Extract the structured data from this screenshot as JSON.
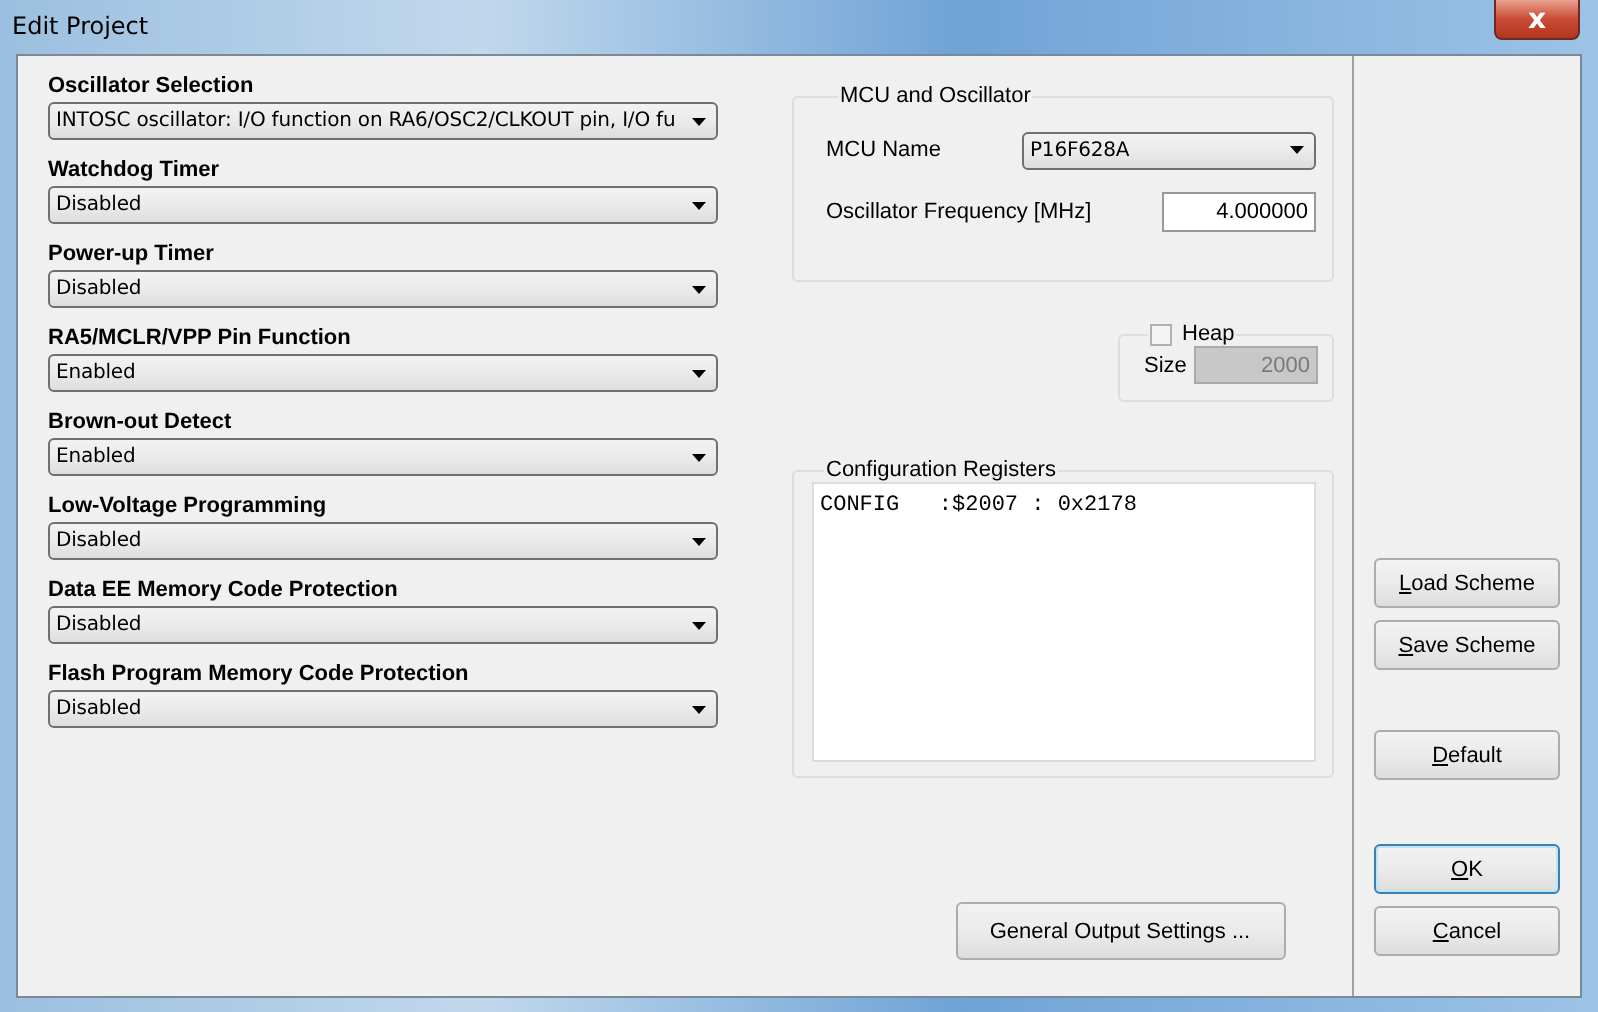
{
  "window": {
    "title": "Edit Project",
    "close": "x"
  },
  "settings": [
    {
      "label": "Oscillator Selection",
      "value": "INTOSC oscillator: I/O function on RA6/OSC2/CLKOUT pin, I/O fu"
    },
    {
      "label": "Watchdog Timer",
      "value": "Disabled"
    },
    {
      "label": "Power-up Timer",
      "value": "Disabled"
    },
    {
      "label": "RA5/MCLR/VPP Pin Function",
      "value": "Enabled"
    },
    {
      "label": "Brown-out Detect",
      "value": "Enabled"
    },
    {
      "label": "Low-Voltage Programming",
      "value": "Disabled"
    },
    {
      "label": "Data EE Memory Code Protection",
      "value": "Disabled"
    },
    {
      "label": "Flash Program Memory Code Protection",
      "value": "Disabled"
    }
  ],
  "mcu_group": {
    "title": "MCU and Oscillator",
    "mcu_label": "MCU Name",
    "mcu_value": "P16F628A",
    "freq_label": "Oscillator Frequency [MHz]",
    "freq_value": "4.000000"
  },
  "heap": {
    "label": "Heap",
    "checked": false,
    "size_label": "Size",
    "size_value": "2000",
    "disabled": true
  },
  "config_group": {
    "title": "Configuration Registers",
    "text": "CONFIG   :$2007 : 0x2178"
  },
  "general_button": "General Output Settings ...",
  "side_buttons": [
    {
      "label": "Load Scheme",
      "underline_first": true,
      "focused": false
    },
    {
      "label": "Save Scheme",
      "underline_first": true,
      "focused": false
    },
    {
      "label": "Default",
      "underline_first": true,
      "focused": false
    },
    {
      "label": "OK",
      "underline_first": true,
      "focused": true
    },
    {
      "label": "Cancel",
      "underline_first": true,
      "focused": false
    }
  ]
}
